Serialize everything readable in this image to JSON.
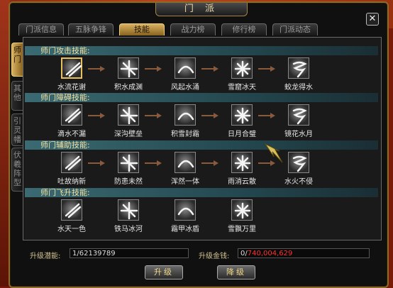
{
  "window": {
    "title": "门  派"
  },
  "tabs": [
    {
      "label": "门派信息",
      "active": false
    },
    {
      "label": "五脉争锋",
      "active": false
    },
    {
      "label": "技能",
      "active": true
    },
    {
      "label": "战力榜",
      "active": false
    },
    {
      "label": "修行榜",
      "active": false
    },
    {
      "label": "门派动态",
      "active": false
    }
  ],
  "side_tabs": [
    {
      "label": "师门",
      "active": true
    },
    {
      "label": "其他",
      "active": false
    },
    {
      "label": "引灵幡",
      "active": false
    },
    {
      "label": "伏羲阵型",
      "active": false
    }
  ],
  "rows": [
    {
      "header": "师门攻击技能:",
      "skills": [
        {
          "name": "水流花谢",
          "icon": "water-blade-icon",
          "selected": true
        },
        {
          "name": "积水成渊",
          "icon": "light-burst-icon"
        },
        {
          "name": "风起水涌",
          "icon": "wind-wave-icon"
        },
        {
          "name": "雪窟冰天",
          "icon": "ice-burst-icon"
        },
        {
          "name": "蛟龙得水",
          "icon": "whirlpool-icon"
        }
      ]
    },
    {
      "header": "师门障碍技能:",
      "skills": [
        {
          "name": "滴水不漏",
          "icon": "dragon-claw-icon"
        },
        {
          "name": "深沟壁垒",
          "icon": "barrier-icon"
        },
        {
          "name": "积雪封霜",
          "icon": "frost-bird-icon"
        },
        {
          "name": "日月合璧",
          "icon": "sun-moon-icon"
        },
        {
          "name": "镜花水月",
          "icon": "beast-icon"
        }
      ]
    },
    {
      "header": "师门辅助技能:",
      "skills": [
        {
          "name": "吐故纳新",
          "icon": "breath-icon"
        },
        {
          "name": "防患未然",
          "icon": "lotus-guard-icon"
        },
        {
          "name": "浑然一体",
          "icon": "lotus-icon"
        },
        {
          "name": "雨消云散",
          "icon": "rain-icon"
        },
        {
          "name": "水火不侵",
          "icon": "fire-water-icon"
        }
      ]
    },
    {
      "header": "师门飞升技能:",
      "skills": [
        {
          "name": "水天一色",
          "icon": "sky-water-icon"
        },
        {
          "name": "铁马冰河",
          "icon": "iron-horse-icon"
        },
        {
          "name": "霜甲冰盾",
          "icon": "frost-shield-icon"
        },
        {
          "name": "雪飘万里",
          "icon": "snow-drift-icon"
        }
      ]
    }
  ],
  "footer": {
    "potential_label": "升级潜能:",
    "potential_value": "1/62139789",
    "money_label": "升级金钱:",
    "money_prefix": "0/",
    "money_value": "740,004,629",
    "money_color": "#ff3030",
    "upgrade_label": "升级",
    "downgrade_label": "降级"
  }
}
